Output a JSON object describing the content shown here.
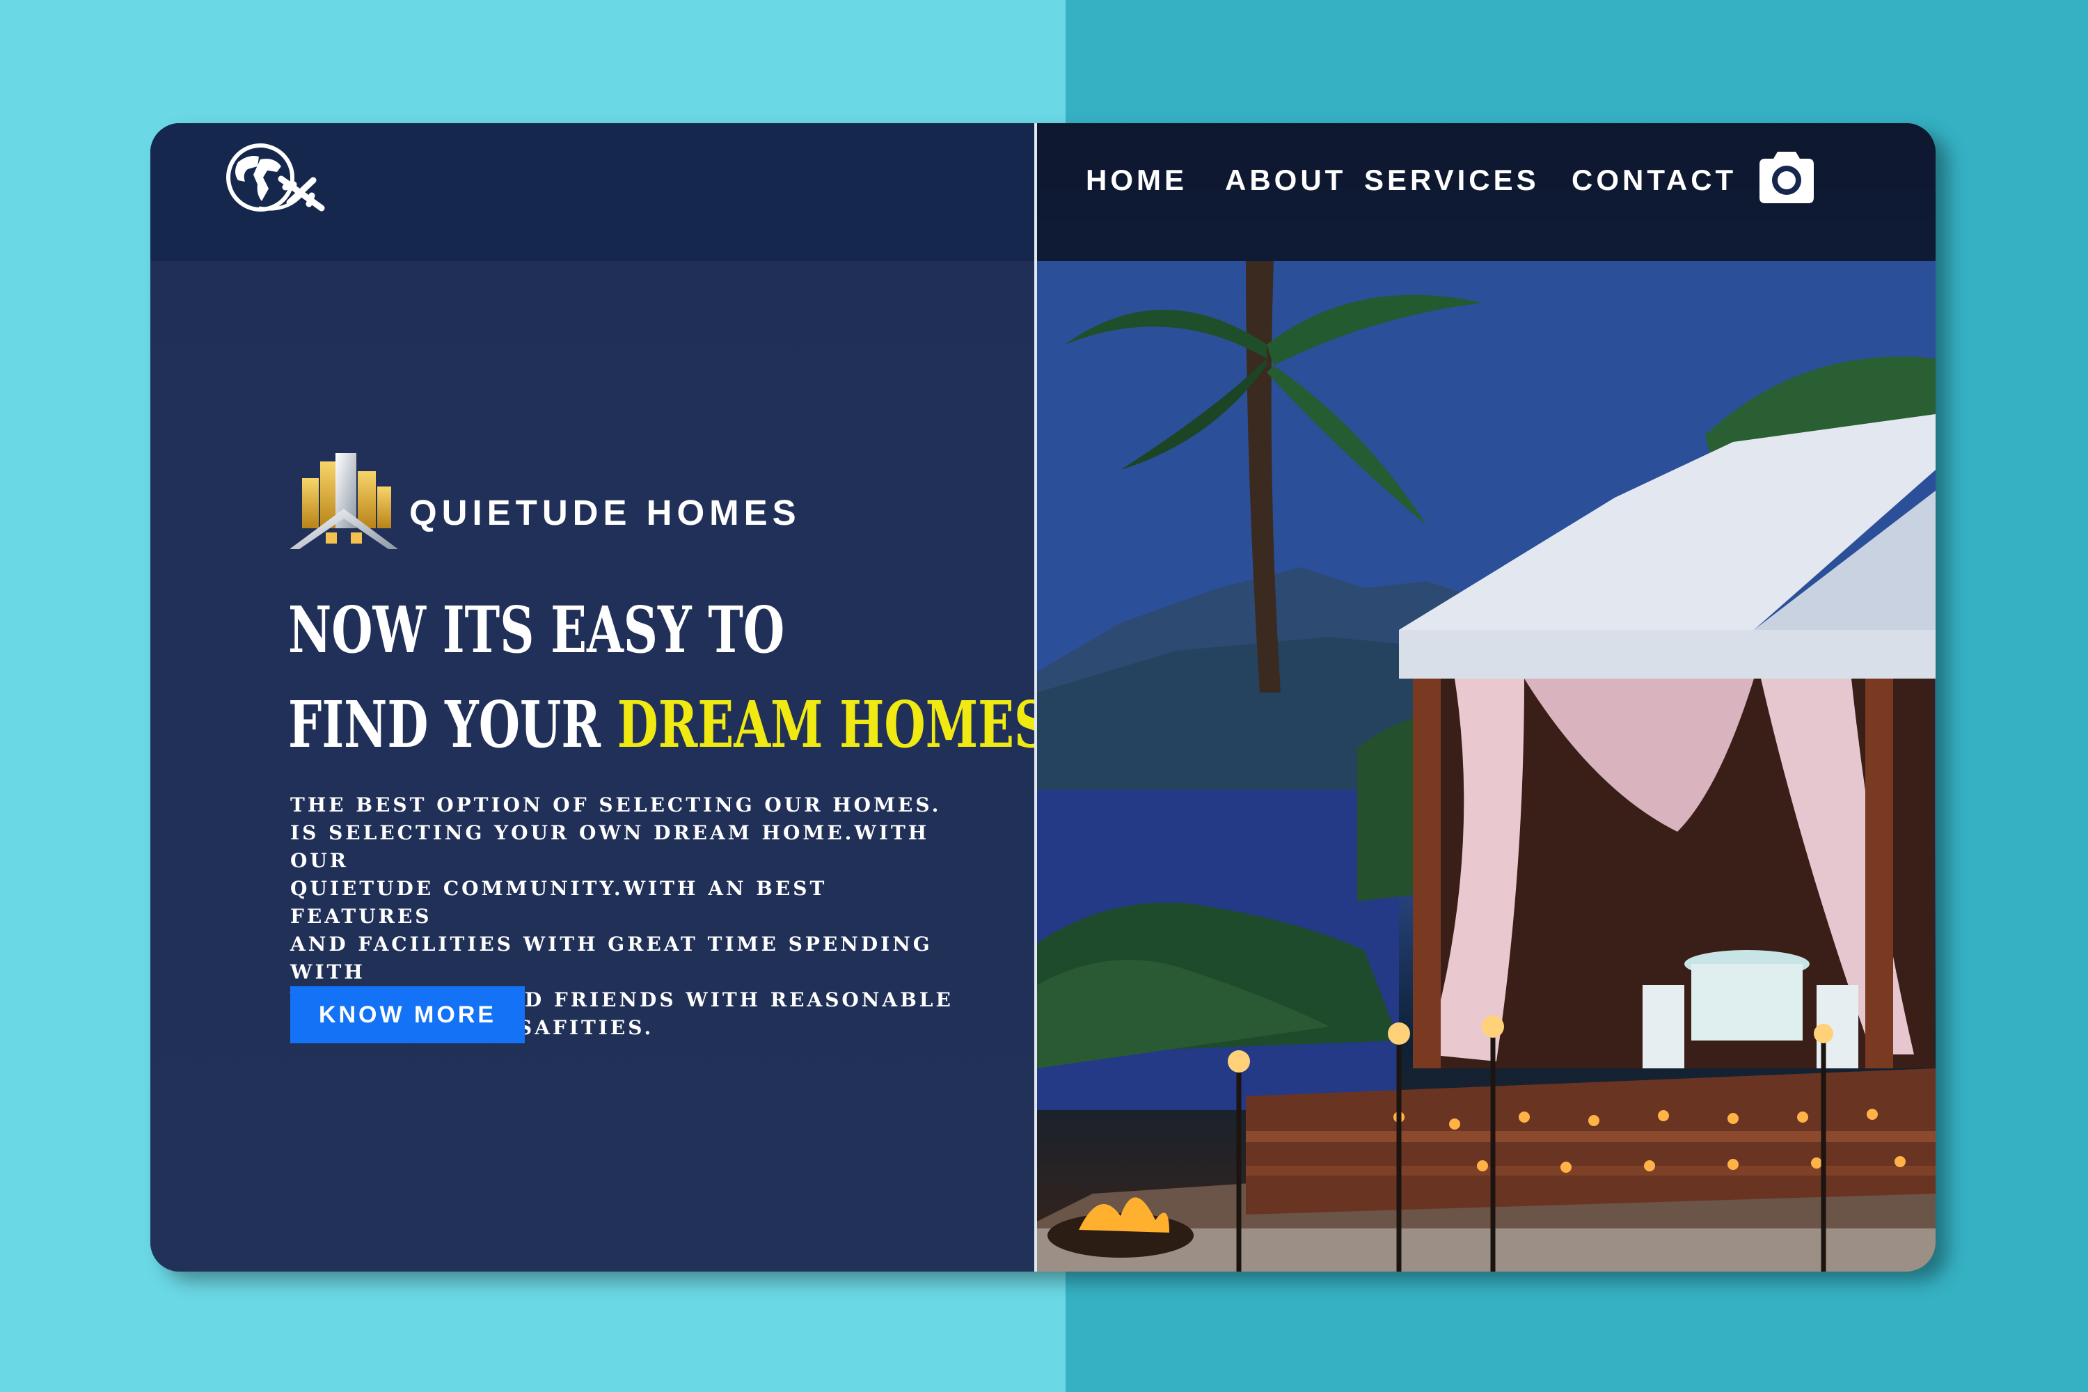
{
  "header": {
    "logo_icon": "globe-airplane-icon",
    "nav": {
      "home": "HOME",
      "about": "ABOUT",
      "services": "SERVICES",
      "contact": "CONTACT"
    },
    "camera_icon": "camera-icon"
  },
  "hero": {
    "brand_icon": "buildings-house-icon",
    "brand_name": "QUIETUDE HOMES",
    "headline_line1": "NOW ITS EASY TO",
    "headline_line2_prefix": "FIND YOUR",
    "headline_line2_highlight": "DREAM HOMES",
    "description_lines": [
      "THE BEST OPTION OF SELECTING OUR HOMES.",
      "IS SELECTING YOUR OWN DREAM HOME.WITH OUR",
      "QUIETUDE COMMUNITY.WITH AN BEST FEATURES",
      "AND FACILITIES WITH GREAT TIME SPENDING WITH",
      "YOUR FAMILY AND FRIENDS WITH REASONABLE",
      "INCLUDING ALL SAFITIES."
    ],
    "cta_label": "KNOW MORE"
  },
  "colors": {
    "background_left": "#6bd8e5",
    "background_right": "#35b1c3",
    "panel": "#1f2f58",
    "panel_header": "#16274e",
    "highlight": "#f0ea12",
    "button": "#1372f5"
  }
}
